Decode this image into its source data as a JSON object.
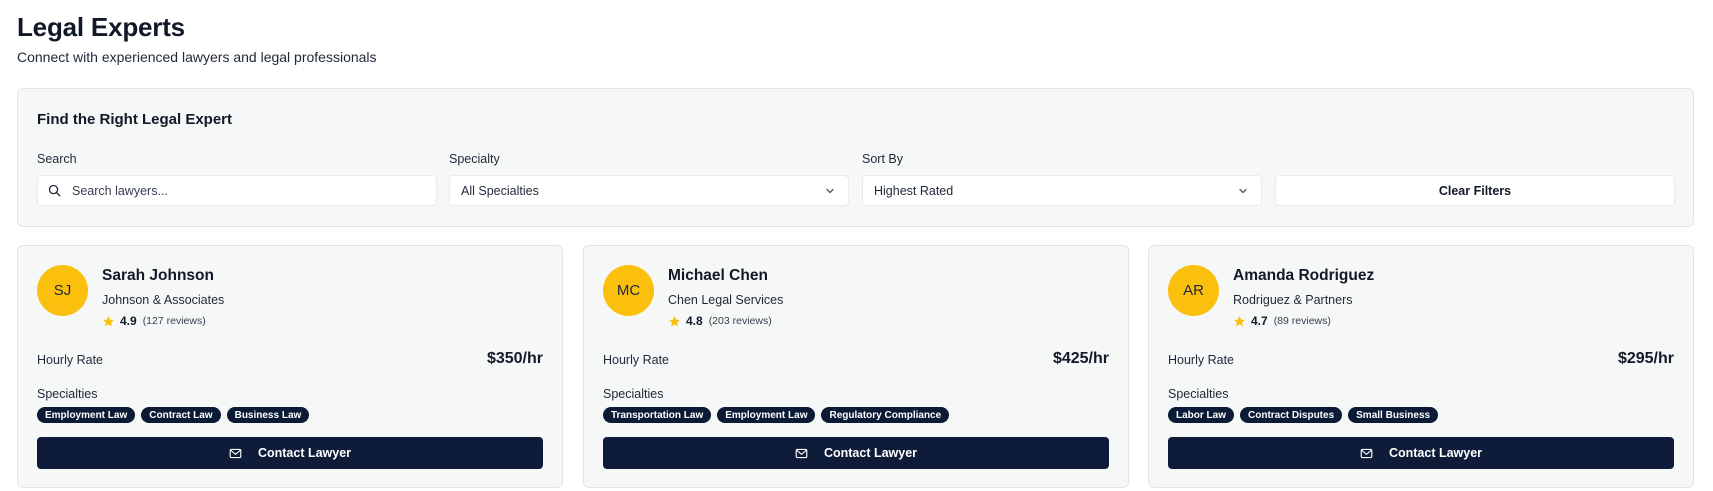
{
  "page": {
    "title": "Legal Experts",
    "subtitle": "Connect with experienced lawyers and legal professionals"
  },
  "filters": {
    "heading": "Find the Right Legal Expert",
    "search_label": "Search",
    "search_placeholder": "Search lawyers...",
    "specialty_label": "Specialty",
    "specialty_value": "All Specialties",
    "sort_label": "Sort By",
    "sort_value": "Highest Rated",
    "clear_label": "Clear Filters"
  },
  "colors": {
    "avatar": "#fbbf0d",
    "primary_button": "#0e1c3a",
    "tag": "#0b1b36",
    "star": "#fbbf0d"
  },
  "lawyers": [
    {
      "initials": "SJ",
      "name": "Sarah Johnson",
      "firm": "Johnson & Associates",
      "rating": "4.9",
      "reviews": "(127 reviews)",
      "rate_label": "Hourly Rate",
      "rate": "$350/hr",
      "specialties_label": "Specialties",
      "specialties": [
        "Employment Law",
        "Contract Law",
        "Business Law"
      ],
      "contact_label": "Contact Lawyer"
    },
    {
      "initials": "MC",
      "name": "Michael Chen",
      "firm": "Chen Legal Services",
      "rating": "4.8",
      "reviews": "(203 reviews)",
      "rate_label": "Hourly Rate",
      "rate": "$425/hr",
      "specialties_label": "Specialties",
      "specialties": [
        "Transportation Law",
        "Employment Law",
        "Regulatory Compliance"
      ],
      "contact_label": "Contact Lawyer"
    },
    {
      "initials": "AR",
      "name": "Amanda Rodriguez",
      "firm": "Rodriguez & Partners",
      "rating": "4.7",
      "reviews": "(89 reviews)",
      "rate_label": "Hourly Rate",
      "rate": "$295/hr",
      "specialties_label": "Specialties",
      "specialties": [
        "Labor Law",
        "Contract Disputes",
        "Small Business"
      ],
      "contact_label": "Contact Lawyer"
    }
  ]
}
